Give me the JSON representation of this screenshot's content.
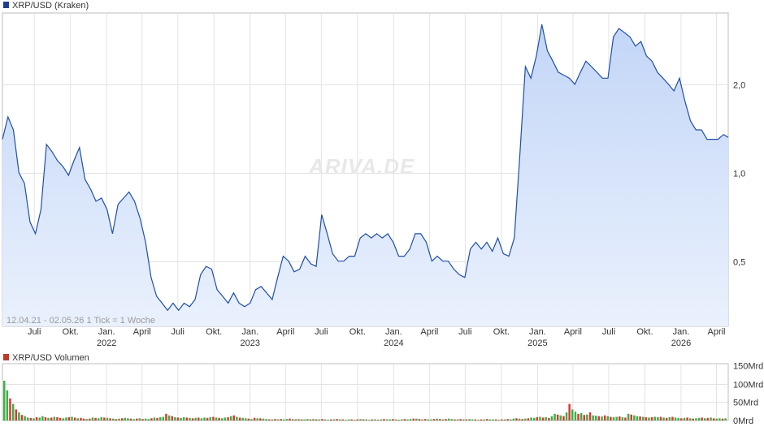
{
  "chart_data": [
    {
      "type": "area",
      "legend": "XRP/USD (Kraken)",
      "info_text": "12.04.21 - 02.05.26    1 Tick = 1 Woche",
      "watermark": "ARIVA.DE",
      "colors": {
        "line": "#1f4fa8",
        "fill_top": "#c3d6f7",
        "fill_bottom": "#eaf1fd",
        "legend_marker": "#1e3f8f"
      },
      "y_scale": "log",
      "ylim": [
        0.3,
        3.5
      ],
      "y_ticks": [
        {
          "value": 0.5,
          "label": "0,5"
        },
        {
          "value": 1.0,
          "label": "1,0"
        },
        {
          "value": 2.0,
          "label": "2,0"
        }
      ],
      "x_ticks": [
        {
          "date": "2021-07",
          "label": "Juli"
        },
        {
          "date": "2021-10",
          "label": "Okt."
        },
        {
          "date": "2022-01",
          "label": "Jan."
        },
        {
          "date": "2022-04",
          "label": "April"
        },
        {
          "date": "2022-07",
          "label": "Juli"
        },
        {
          "date": "2022-10",
          "label": "Okt."
        },
        {
          "date": "2023-01",
          "label": "Jan."
        },
        {
          "date": "2023-04",
          "label": "April"
        },
        {
          "date": "2023-07",
          "label": "Juli"
        },
        {
          "date": "2023-10",
          "label": "Okt."
        },
        {
          "date": "2024-01",
          "label": "Jan."
        },
        {
          "date": "2024-04",
          "label": "April"
        },
        {
          "date": "2024-07",
          "label": "Juli"
        },
        {
          "date": "2024-10",
          "label": "Okt."
        },
        {
          "date": "2025-01",
          "label": "Jan."
        },
        {
          "date": "2025-04",
          "label": "April"
        },
        {
          "date": "2025-07",
          "label": "Juli"
        },
        {
          "date": "2025-10",
          "label": "Okt."
        },
        {
          "date": "2026-01",
          "label": "Jan."
        },
        {
          "date": "2026-04",
          "label": "April"
        }
      ],
      "year_labels": [
        "2022",
        "2023",
        "2024",
        "2025",
        "2026"
      ],
      "grid": true,
      "series": [
        {
          "x": [
            "2021-04-12",
            "2021-04-26",
            "2021-05-10",
            "2021-05-24",
            "2021-06-07",
            "2021-06-21",
            "2021-07-05",
            "2021-07-19",
            "2021-08-02",
            "2021-08-16",
            "2021-08-30",
            "2021-09-13",
            "2021-09-27",
            "2021-10-11",
            "2021-10-25",
            "2021-11-08",
            "2021-11-22",
            "2021-12-06",
            "2021-12-20",
            "2022-01-03",
            "2022-01-17",
            "2022-01-31",
            "2022-02-14",
            "2022-02-28",
            "2022-03-14",
            "2022-03-28",
            "2022-04-11",
            "2022-04-25",
            "2022-05-09",
            "2022-05-23",
            "2022-06-06",
            "2022-06-20",
            "2022-07-04",
            "2022-07-18",
            "2022-08-01",
            "2022-08-15",
            "2022-08-29",
            "2022-09-12",
            "2022-09-26",
            "2022-10-10",
            "2022-10-24",
            "2022-11-07",
            "2022-11-21",
            "2022-12-05",
            "2022-12-19",
            "2023-01-02",
            "2023-01-16",
            "2023-01-30",
            "2023-02-13",
            "2023-02-27",
            "2023-03-13",
            "2023-03-27",
            "2023-04-10",
            "2023-04-24",
            "2023-05-08",
            "2023-05-22",
            "2023-06-05",
            "2023-06-19",
            "2023-07-03",
            "2023-07-17",
            "2023-07-31",
            "2023-08-14",
            "2023-08-28",
            "2023-09-11",
            "2023-09-25",
            "2023-10-09",
            "2023-10-23",
            "2023-11-06",
            "2023-11-20",
            "2023-12-04",
            "2023-12-18",
            "2024-01-01",
            "2024-01-15",
            "2024-01-29",
            "2024-02-12",
            "2024-02-26",
            "2024-03-11",
            "2024-03-25",
            "2024-04-08",
            "2024-04-22",
            "2024-05-06",
            "2024-05-20",
            "2024-06-03",
            "2024-06-17",
            "2024-07-01",
            "2024-07-15",
            "2024-07-29",
            "2024-08-12",
            "2024-08-26",
            "2024-09-09",
            "2024-09-23",
            "2024-10-07",
            "2024-10-21",
            "2024-11-04",
            "2024-11-18",
            "2024-12-02",
            "2024-12-16",
            "2024-12-30",
            "2025-01-13",
            "2025-01-27",
            "2025-02-10",
            "2025-02-24",
            "2025-03-10",
            "2025-03-24",
            "2025-04-07",
            "2025-04-21",
            "2025-05-05",
            "2025-05-19",
            "2025-06-02",
            "2025-06-16",
            "2025-06-30",
            "2025-07-14",
            "2025-07-28",
            "2025-08-11",
            "2025-08-25",
            "2025-09-08",
            "2025-09-22",
            "2025-10-06",
            "2025-10-20",
            "2025-11-03",
            "2025-11-17",
            "2025-12-01",
            "2025-12-15",
            "2025-12-29",
            "2026-01-12",
            "2026-01-26",
            "2026-02-09",
            "2026-02-23",
            "2026-03-09",
            "2026-03-23",
            "2026-04-06",
            "2026-04-20",
            "2026-05-02"
          ],
          "y": [
            1.3,
            1.55,
            1.4,
            1.0,
            0.92,
            0.68,
            0.62,
            0.75,
            1.25,
            1.18,
            1.1,
            1.05,
            0.98,
            1.1,
            1.22,
            0.95,
            0.88,
            0.8,
            0.82,
            0.75,
            0.62,
            0.78,
            0.82,
            0.86,
            0.8,
            0.7,
            0.58,
            0.44,
            0.38,
            0.36,
            0.34,
            0.36,
            0.34,
            0.36,
            0.35,
            0.37,
            0.45,
            0.48,
            0.47,
            0.4,
            0.38,
            0.36,
            0.39,
            0.36,
            0.35,
            0.36,
            0.4,
            0.41,
            0.39,
            0.37,
            0.44,
            0.52,
            0.5,
            0.46,
            0.47,
            0.52,
            0.49,
            0.48,
            0.72,
            0.62,
            0.53,
            0.5,
            0.5,
            0.52,
            0.52,
            0.6,
            0.62,
            0.6,
            0.62,
            0.6,
            0.62,
            0.58,
            0.52,
            0.52,
            0.55,
            0.62,
            0.62,
            0.58,
            0.5,
            0.52,
            0.5,
            0.5,
            0.47,
            0.45,
            0.44,
            0.55,
            0.58,
            0.55,
            0.58,
            0.54,
            0.6,
            0.53,
            0.52,
            0.6,
            1.15,
            2.3,
            2.1,
            2.5,
            3.2,
            2.6,
            2.4,
            2.2,
            2.15,
            2.1,
            2.0,
            2.2,
            2.4,
            2.3,
            2.2,
            2.1,
            2.1,
            2.9,
            3.1,
            3.0,
            2.9,
            2.7,
            2.8,
            2.5,
            2.4,
            2.2,
            2.1,
            2.0,
            1.9,
            2.1,
            1.75,
            1.5,
            1.4,
            1.4,
            1.3,
            1.3,
            1.3,
            1.35,
            1.32
          ]
        }
      ]
    },
    {
      "type": "bar",
      "legend": "XRP/USD Volumen",
      "colors": {
        "up": "#3cb043",
        "down": "#d9383a",
        "legend_marker": "#c0392b"
      },
      "ylim": [
        0,
        150
      ],
      "y_unit": "Mrd",
      "y_ticks": [
        {
          "value": 150,
          "label": "150Mrd"
        },
        {
          "value": 100,
          "label": "100Mrd"
        },
        {
          "value": 50,
          "label": "50Mrd"
        },
        {
          "value": 0,
          "label": "0Mrd"
        }
      ],
      "series": [
        {
          "name": "Volumen",
          "values": [
            108,
            82,
            60,
            45,
            30,
            22,
            15,
            12,
            8,
            7,
            6,
            9,
            8,
            12,
            9,
            7,
            8,
            10,
            9,
            7,
            6,
            8,
            9,
            10,
            8,
            6,
            7,
            5,
            4,
            5,
            8,
            7,
            6,
            9,
            8,
            7,
            6,
            5,
            4,
            5,
            6,
            7,
            6,
            5,
            4,
            5,
            6,
            4,
            5,
            4,
            6,
            8,
            7,
            9,
            10,
            18,
            14,
            12,
            9,
            8,
            7,
            9,
            8,
            7,
            6,
            7,
            8,
            6,
            8,
            7,
            9,
            10,
            8,
            7,
            6,
            8,
            9,
            12,
            14,
            10,
            8,
            7,
            6,
            5,
            4,
            7,
            6,
            6,
            5,
            4,
            3,
            3,
            4,
            3,
            4,
            3,
            4,
            5,
            4,
            3,
            4,
            3,
            3,
            4,
            3,
            4,
            3,
            3,
            4,
            3,
            2,
            3,
            3,
            4,
            3,
            3,
            2,
            3,
            3,
            2,
            3,
            4,
            3,
            3,
            2,
            3,
            3,
            2,
            3,
            4,
            3,
            3,
            4,
            3,
            2,
            3,
            4,
            3,
            4,
            5,
            5,
            4,
            3,
            4,
            3,
            3,
            4,
            5,
            4,
            3,
            4,
            5,
            4,
            3,
            3,
            4,
            3,
            3,
            4,
            3,
            3,
            2,
            3,
            3,
            4,
            3,
            3,
            3,
            2,
            3,
            3,
            4,
            3,
            5,
            6,
            5,
            4,
            5,
            6,
            8,
            7,
            9,
            10,
            8,
            9,
            7,
            12,
            18,
            16,
            14,
            12,
            22,
            45,
            30,
            24,
            18,
            20,
            15,
            16,
            22,
            14,
            13,
            12,
            11,
            14,
            12,
            10,
            9,
            10,
            11,
            9,
            8,
            18,
            16,
            14,
            12,
            11,
            10,
            9,
            8,
            9,
            10,
            9,
            10,
            8,
            7,
            9,
            10,
            8,
            7,
            6,
            7,
            8,
            6,
            5,
            6,
            7,
            8,
            6,
            7,
            8,
            6,
            5,
            6,
            5,
            6
          ],
          "up": [
            true,
            true,
            false,
            true,
            false,
            true,
            false,
            true,
            true,
            false,
            true,
            false,
            true,
            true,
            false,
            true,
            false,
            true,
            false,
            false,
            true,
            true,
            false,
            true,
            false,
            true,
            false,
            false,
            true,
            false,
            true,
            false,
            true,
            true,
            false,
            true,
            false,
            true,
            false,
            true,
            false,
            true,
            true,
            false,
            true,
            false,
            true,
            false,
            true,
            true,
            false,
            true,
            false,
            true,
            true,
            false,
            true,
            false,
            true,
            false,
            true,
            true,
            false,
            true,
            false,
            true,
            false,
            true,
            true,
            false,
            true,
            false,
            true,
            false,
            true,
            true,
            false,
            true,
            false,
            true,
            false,
            true,
            true,
            false,
            true,
            false,
            true,
            false,
            true,
            true,
            false,
            true,
            false,
            true,
            false,
            true,
            true,
            false,
            true,
            false,
            true,
            false,
            true,
            true,
            false,
            true,
            false,
            true,
            false,
            true,
            true,
            false,
            true,
            false,
            true,
            false,
            true,
            true,
            false,
            true,
            false,
            true,
            false,
            true,
            true,
            false,
            true,
            false,
            true,
            false,
            true,
            true,
            false,
            true,
            false,
            true,
            false,
            true,
            true,
            false,
            true,
            false,
            true,
            false,
            true,
            true,
            false,
            true,
            false,
            true,
            false,
            true,
            true,
            false,
            true,
            false,
            true,
            false,
            true,
            true,
            false,
            true,
            false,
            true,
            false,
            true,
            true,
            false,
            true,
            false,
            true,
            false,
            true,
            true,
            false,
            true,
            false,
            true,
            false,
            true,
            true,
            false,
            true,
            false,
            true,
            false,
            true,
            true,
            false,
            true,
            false,
            true,
            false,
            true,
            true,
            false,
            true,
            false,
            true,
            false,
            true,
            true,
            false,
            true,
            false,
            true,
            false,
            true,
            true,
            false,
            true,
            false,
            true,
            false,
            true,
            true,
            false,
            true,
            false,
            true,
            false,
            true,
            true,
            false,
            true,
            false,
            true,
            false,
            true,
            true,
            false,
            true,
            false,
            true,
            false,
            true,
            true,
            false,
            true,
            false,
            true,
            false,
            true,
            true,
            false,
            true,
            false,
            true,
            false,
            true,
            true,
            false,
            true,
            false
          ]
        }
      ]
    }
  ]
}
